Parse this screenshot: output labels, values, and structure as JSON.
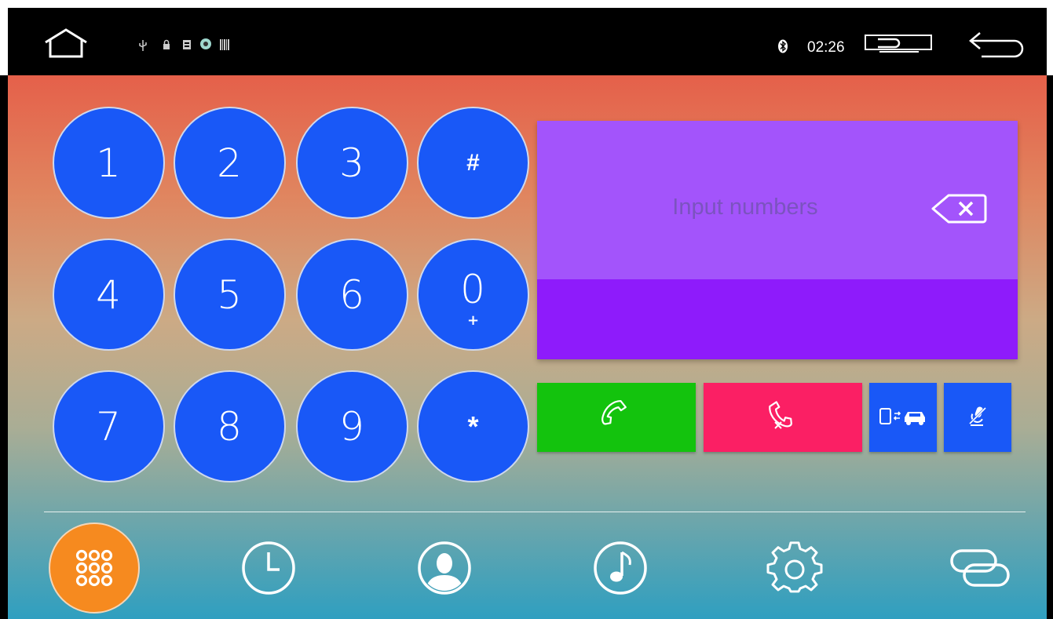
{
  "status_bar": {
    "time": "02:26",
    "left_icons": [
      "home-icon",
      "usb-icon",
      "lock-icon",
      "sd-card-icon",
      "app-icon",
      "barcode-icon"
    ],
    "right_icons": [
      "bluetooth-icon",
      "screen-toggle-icon",
      "back-icon"
    ]
  },
  "keypad": {
    "keys": [
      {
        "label": "1"
      },
      {
        "label": "2"
      },
      {
        "label": "3"
      },
      {
        "label": "#"
      },
      {
        "label": "4"
      },
      {
        "label": "5"
      },
      {
        "label": "6"
      },
      {
        "label": "0",
        "sub": "+"
      },
      {
        "label": "7"
      },
      {
        "label": "8"
      },
      {
        "label": "9"
      },
      {
        "label": "*"
      }
    ]
  },
  "display": {
    "placeholder": "Input numbers",
    "value": ""
  },
  "actions": {
    "call_icon": "phone-icon",
    "hangup_icon": "hang-up-icon",
    "transfer_icon": "phone-to-car-icon",
    "mute_icon": "mic-mute-icon"
  },
  "bottom_nav": {
    "items": [
      "dialpad-icon",
      "recent-calls-icon",
      "contacts-icon",
      "music-icon",
      "settings-icon",
      "link-icon"
    ],
    "active": "dialpad-icon"
  },
  "colors": {
    "key_blue": "#1958f7",
    "call_green": "#13c30d",
    "hangup_red": "#fb1f64",
    "display_top": "#a354fb",
    "display_bottom": "#8e1bfb",
    "active_nav_orange": "#f68a1f"
  }
}
